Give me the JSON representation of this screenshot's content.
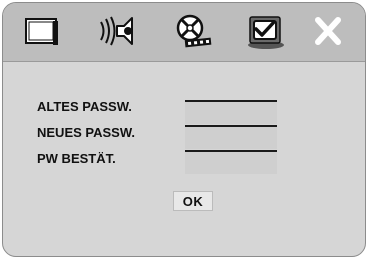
{
  "toolbar": {
    "tabs": [
      {
        "icon": "tv-screen-icon"
      },
      {
        "icon": "speaker-sound-icon"
      },
      {
        "icon": "disc-film-icon"
      },
      {
        "icon": "preferences-checkbox-icon",
        "active": true
      },
      {
        "icon": "close-icon"
      }
    ]
  },
  "form": {
    "old_password_label": "ALTES PASSW.",
    "new_password_label": "NEUES PASSW.",
    "confirm_password_label": "PW BESTÄT.",
    "old_password_value": "",
    "new_password_value": "",
    "confirm_password_value": ""
  },
  "ok_label": "OK",
  "colors": {
    "panel": "#d6d6d6",
    "toolbar": "#bdbdbd",
    "field": "#cfcfcf",
    "text": "#111111"
  }
}
